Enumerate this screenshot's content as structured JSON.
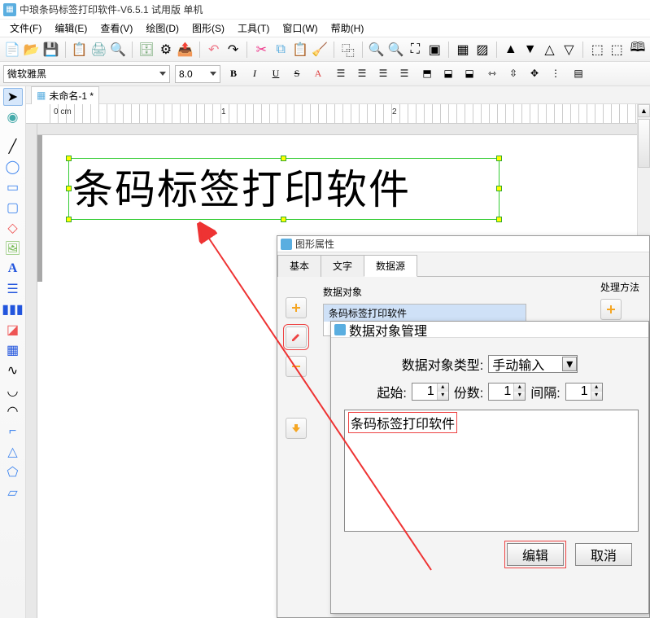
{
  "titlebar": {
    "text": "中琅条码标签打印软件-V6.5.1 试用版 单机"
  },
  "menu": {
    "file": "文件(F)",
    "edit": "编辑(E)",
    "view": "查看(V)",
    "draw": "绘图(D)",
    "graphic": "图形(S)",
    "tool": "工具(T)",
    "window": "窗口(W)",
    "help": "帮助(H)"
  },
  "format": {
    "font": "微软雅黑",
    "size": "8.0"
  },
  "doc": {
    "name": "未命名-1 *"
  },
  "ruler": {
    "origin": "0 cm",
    "t1": "1",
    "t2": "2"
  },
  "canvas": {
    "text": "条码标签打印软件"
  },
  "props": {
    "title": "图形属性",
    "tabs": {
      "basic": "基本",
      "text": "文字",
      "data": "数据源"
    },
    "data_obj_label": "数据对象",
    "process_label": "处理方法",
    "list_item": "条码标签打印软件"
  },
  "mgr": {
    "title": "数据对象管理",
    "type_label": "数据对象类型:",
    "type_value": "手动输入",
    "start_label": "起始:",
    "start_value": "1",
    "count_label": "份数:",
    "count_value": "1",
    "gap_label": "间隔:",
    "gap_value": "1",
    "text_value": "条码标签打印软件",
    "btn_edit": "编辑",
    "btn_cancel": "取消"
  }
}
